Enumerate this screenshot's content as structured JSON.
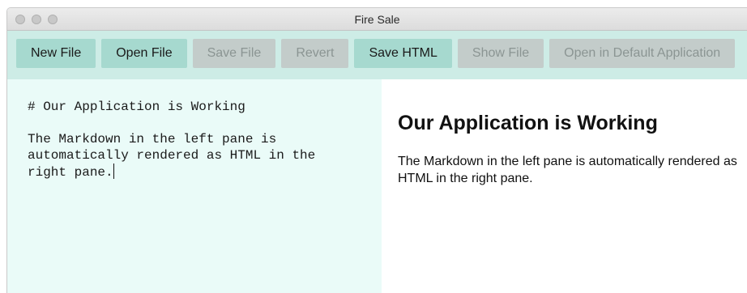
{
  "window": {
    "title": "Fire Sale"
  },
  "toolbar": {
    "new_file": "New File",
    "open_file": "Open File",
    "save_file": "Save File",
    "revert": "Revert",
    "save_html": "Save HTML",
    "show_file": "Show File",
    "open_default": "Open in Default Application"
  },
  "editor": {
    "line1": "# Our Application is Working",
    "line2": "",
    "line3": "The Markdown in the left pane is",
    "line4": "automatically rendered as HTML in the",
    "line5": "right pane."
  },
  "preview": {
    "heading": "Our Application is Working",
    "paragraph": "The Markdown in the left pane is automatically rendered as HTML in the right pane."
  },
  "colors": {
    "toolbar_bg": "#cdece6",
    "button_enabled": "#a6d9cf",
    "button_disabled": "#c3ccca",
    "editor_bg": "#eafbf8"
  }
}
